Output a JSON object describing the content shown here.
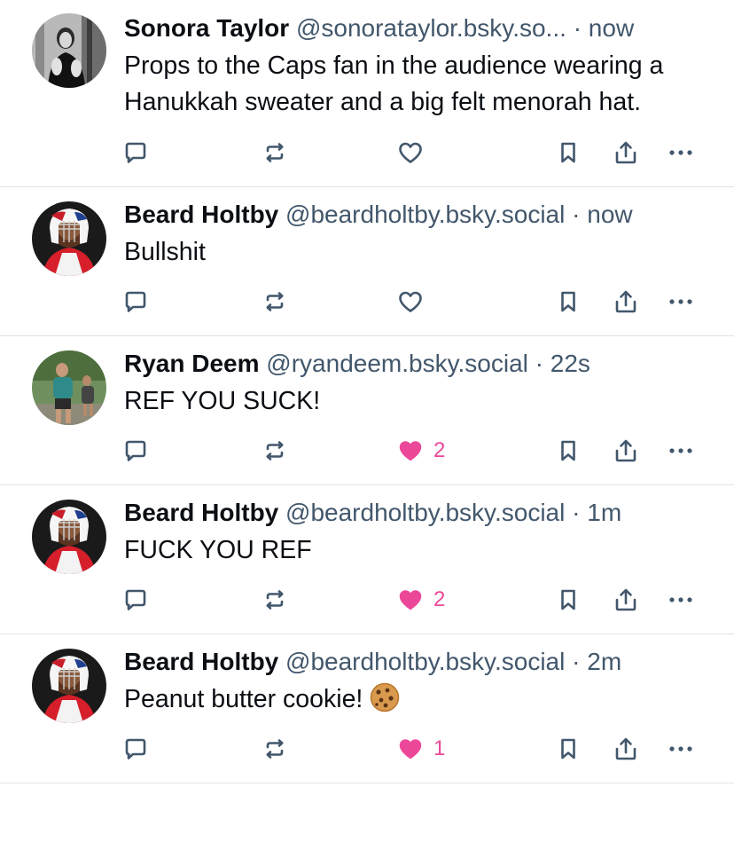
{
  "colors": {
    "icon": "#42576c",
    "liked": "#ec4899",
    "divider": "#dfe3e8",
    "text": "#0b0f14",
    "secondary": "#42576c"
  },
  "posts": [
    {
      "author": "Sonora Taylor",
      "handle": "@sonorataylor.bsky.so...",
      "separator": "·",
      "time": "now",
      "text": "Props to the Caps fan in the audience wearing a Hanukkah sweater and a big felt menorah hat.",
      "liked": false,
      "like_count": "",
      "avatar": "sonora-avatar"
    },
    {
      "author": "Beard Holtby",
      "handle": "@beardholtby.bsky.social",
      "separator": "·",
      "time": "now",
      "text": "Bullshit",
      "liked": false,
      "like_count": "",
      "avatar": "goalie-avatar"
    },
    {
      "author": "Ryan Deem",
      "handle": "@ryandeem.bsky.social",
      "separator": "·",
      "time": "22s",
      "text": "REF YOU SUCK!",
      "liked": true,
      "like_count": "2",
      "avatar": "runner-avatar"
    },
    {
      "author": "Beard Holtby",
      "handle": "@beardholtby.bsky.social",
      "separator": "·",
      "time": "1m",
      "text": "FUCK YOU REF",
      "liked": true,
      "like_count": "2",
      "avatar": "goalie-avatar"
    },
    {
      "author": "Beard Holtby",
      "handle": "@beardholtby.bsky.social",
      "separator": "·",
      "time": "2m",
      "text": "Peanut butter cookie!",
      "liked": true,
      "like_count": "1",
      "avatar": "goalie-avatar"
    }
  ]
}
